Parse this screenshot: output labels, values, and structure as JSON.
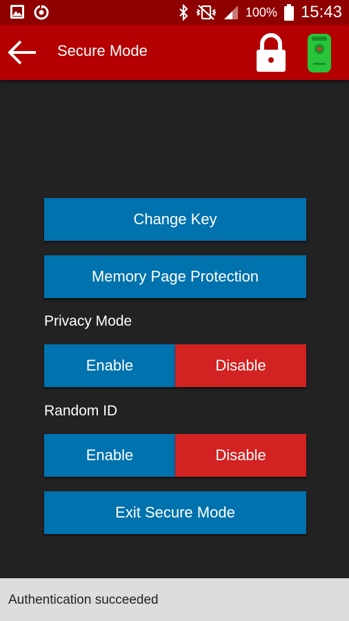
{
  "status_bar": {
    "battery_percent": "100%",
    "time": "15:43",
    "icons": [
      "gallery-icon",
      "sync-icon",
      "bluetooth-icon",
      "vibrate-icon",
      "signal-icon",
      "battery-icon"
    ]
  },
  "app_bar": {
    "title": "Secure Mode",
    "icons": [
      "back-arrow-icon",
      "lock-icon",
      "key-fob-icon"
    ]
  },
  "buttons": {
    "change_key": "Change Key",
    "memory_page_protection": "Memory Page Protection",
    "exit_secure_mode": "Exit Secure Mode"
  },
  "privacy_mode": {
    "label": "Privacy Mode",
    "enable": "Enable",
    "disable": "Disable"
  },
  "random_id": {
    "label": "Random ID",
    "enable": "Enable",
    "disable": "Disable"
  },
  "toast": {
    "message": "Authentication succeeded"
  },
  "colors": {
    "status_bar": "#8f0000",
    "app_bar": "#b40000",
    "background": "#222222",
    "primary_button": "#0072ad",
    "disable_button": "#d32222",
    "key_fob": "#27c43a",
    "toast_bg": "#dddddd"
  }
}
